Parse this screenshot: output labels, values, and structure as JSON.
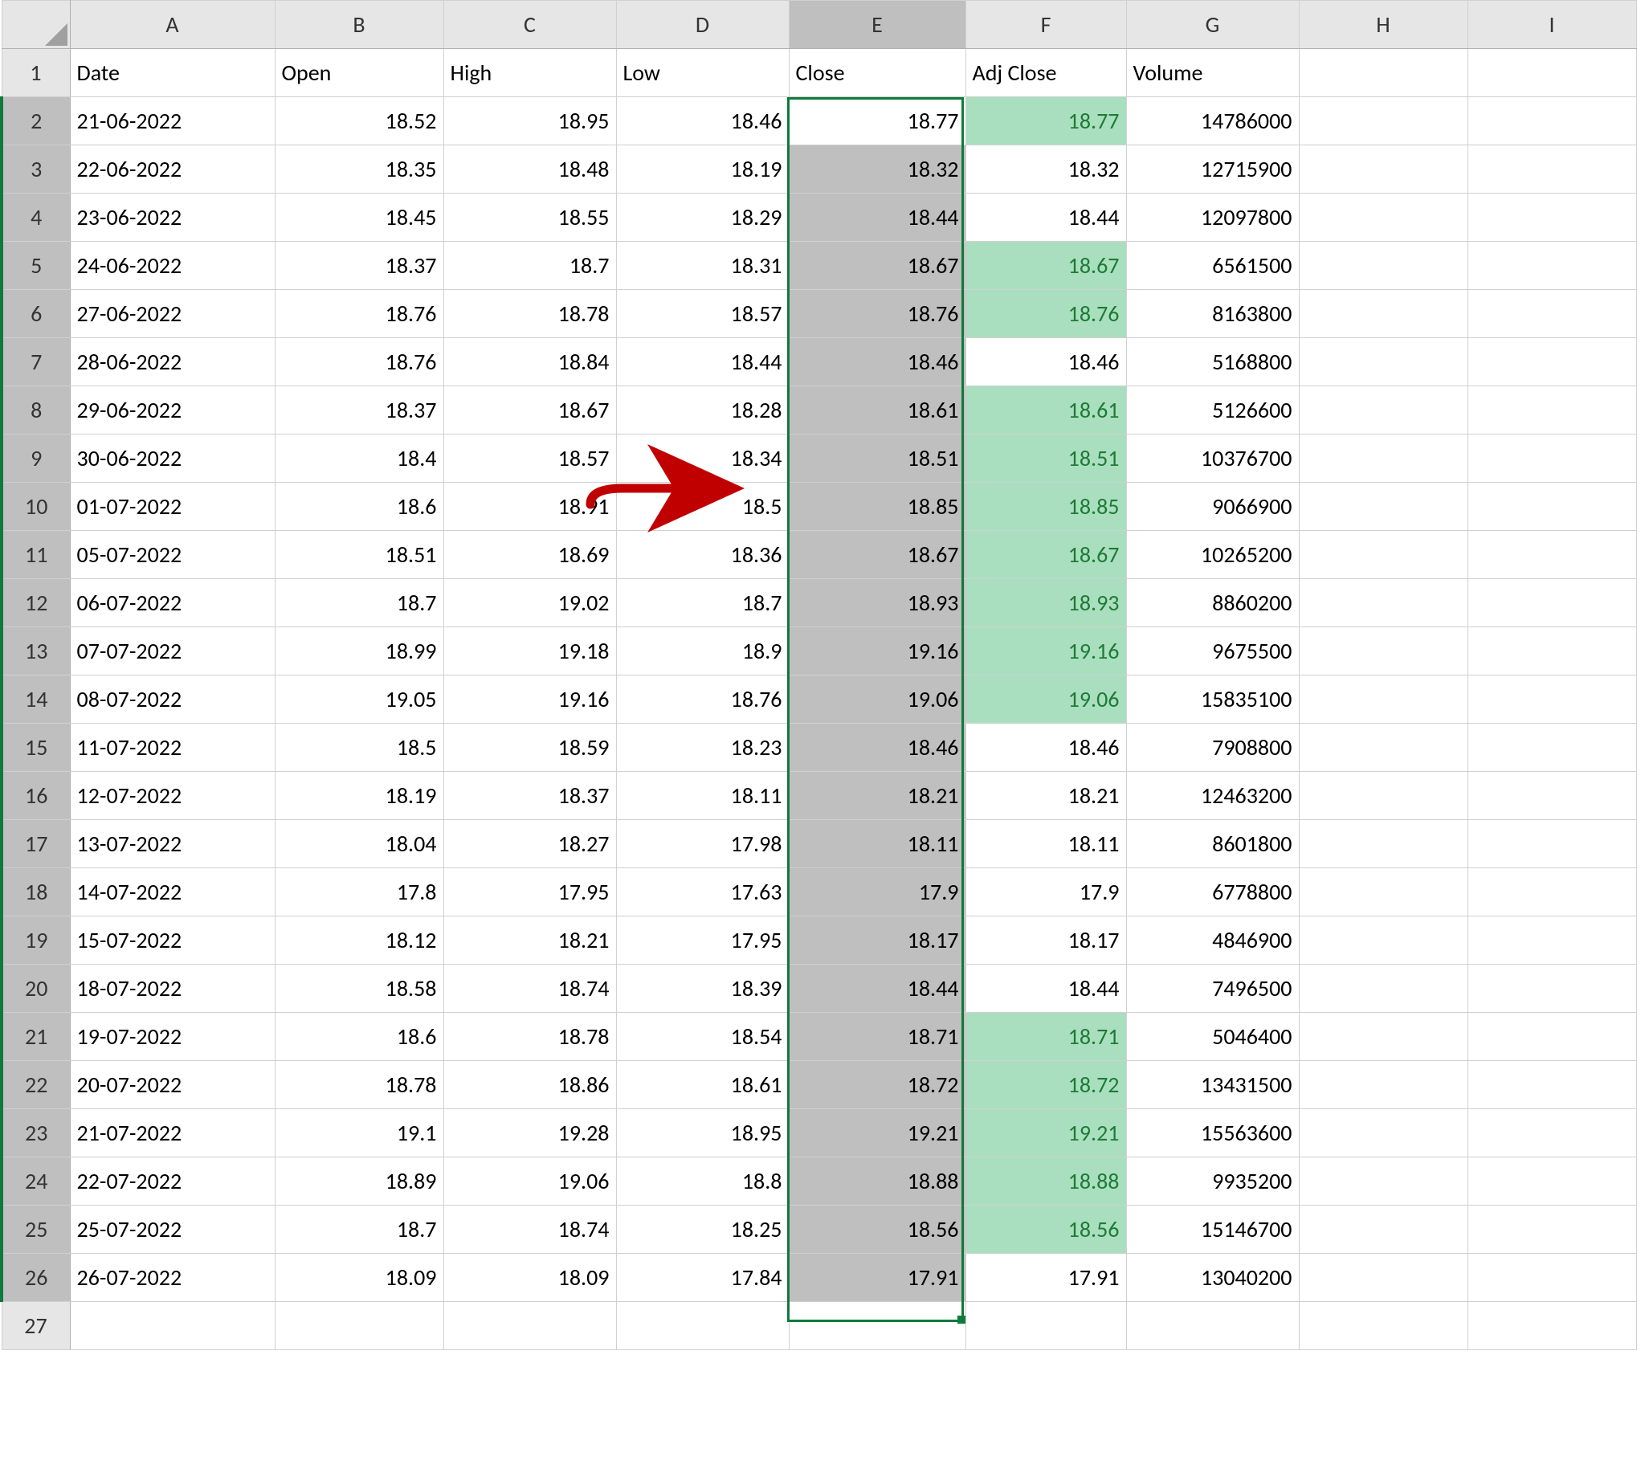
{
  "column_letters": [
    "A",
    "B",
    "C",
    "D",
    "E",
    "F",
    "G",
    "H",
    "I"
  ],
  "headers": {
    "A": "Date",
    "B": "Open",
    "C": "High",
    "D": "Low",
    "E": "Close",
    "F": "Adj Close",
    "G": "Volume"
  },
  "rows": [
    {
      "n": 2,
      "date": "21-06-2022",
      "open": "18.52",
      "high": "18.95",
      "low": "18.46",
      "close": "18.77",
      "adj": "18.77",
      "vol": "14786000",
      "adj_green": true
    },
    {
      "n": 3,
      "date": "22-06-2022",
      "open": "18.35",
      "high": "18.48",
      "low": "18.19",
      "close": "18.32",
      "adj": "18.32",
      "vol": "12715900",
      "adj_green": false
    },
    {
      "n": 4,
      "date": "23-06-2022",
      "open": "18.45",
      "high": "18.55",
      "low": "18.29",
      "close": "18.44",
      "adj": "18.44",
      "vol": "12097800",
      "adj_green": false
    },
    {
      "n": 5,
      "date": "24-06-2022",
      "open": "18.37",
      "high": "18.7",
      "low": "18.31",
      "close": "18.67",
      "adj": "18.67",
      "vol": "6561500",
      "adj_green": true
    },
    {
      "n": 6,
      "date": "27-06-2022",
      "open": "18.76",
      "high": "18.78",
      "low": "18.57",
      "close": "18.76",
      "adj": "18.76",
      "vol": "8163800",
      "adj_green": true
    },
    {
      "n": 7,
      "date": "28-06-2022",
      "open": "18.76",
      "high": "18.84",
      "low": "18.44",
      "close": "18.46",
      "adj": "18.46",
      "vol": "5168800",
      "adj_green": false
    },
    {
      "n": 8,
      "date": "29-06-2022",
      "open": "18.37",
      "high": "18.67",
      "low": "18.28",
      "close": "18.61",
      "adj": "18.61",
      "vol": "5126600",
      "adj_green": true
    },
    {
      "n": 9,
      "date": "30-06-2022",
      "open": "18.4",
      "high": "18.57",
      "low": "18.34",
      "close": "18.51",
      "adj": "18.51",
      "vol": "10376700",
      "adj_green": true
    },
    {
      "n": 10,
      "date": "01-07-2022",
      "open": "18.6",
      "high": "18.91",
      "low": "18.5",
      "close": "18.85",
      "adj": "18.85",
      "vol": "9066900",
      "adj_green": true
    },
    {
      "n": 11,
      "date": "05-07-2022",
      "open": "18.51",
      "high": "18.69",
      "low": "18.36",
      "close": "18.67",
      "adj": "18.67",
      "vol": "10265200",
      "adj_green": true
    },
    {
      "n": 12,
      "date": "06-07-2022",
      "open": "18.7",
      "high": "19.02",
      "low": "18.7",
      "close": "18.93",
      "adj": "18.93",
      "vol": "8860200",
      "adj_green": true
    },
    {
      "n": 13,
      "date": "07-07-2022",
      "open": "18.99",
      "high": "19.18",
      "low": "18.9",
      "close": "19.16",
      "adj": "19.16",
      "vol": "9675500",
      "adj_green": true
    },
    {
      "n": 14,
      "date": "08-07-2022",
      "open": "19.05",
      "high": "19.16",
      "low": "18.76",
      "close": "19.06",
      "adj": "19.06",
      "vol": "15835100",
      "adj_green": true
    },
    {
      "n": 15,
      "date": "11-07-2022",
      "open": "18.5",
      "high": "18.59",
      "low": "18.23",
      "close": "18.46",
      "adj": "18.46",
      "vol": "7908800",
      "adj_green": false
    },
    {
      "n": 16,
      "date": "12-07-2022",
      "open": "18.19",
      "high": "18.37",
      "low": "18.11",
      "close": "18.21",
      "adj": "18.21",
      "vol": "12463200",
      "adj_green": false
    },
    {
      "n": 17,
      "date": "13-07-2022",
      "open": "18.04",
      "high": "18.27",
      "low": "17.98",
      "close": "18.11",
      "adj": "18.11",
      "vol": "8601800",
      "adj_green": false
    },
    {
      "n": 18,
      "date": "14-07-2022",
      "open": "17.8",
      "high": "17.95",
      "low": "17.63",
      "close": "17.9",
      "adj": "17.9",
      "vol": "6778800",
      "adj_green": false
    },
    {
      "n": 19,
      "date": "15-07-2022",
      "open": "18.12",
      "high": "18.21",
      "low": "17.95",
      "close": "18.17",
      "adj": "18.17",
      "vol": "4846900",
      "adj_green": false
    },
    {
      "n": 20,
      "date": "18-07-2022",
      "open": "18.58",
      "high": "18.74",
      "low": "18.39",
      "close": "18.44",
      "adj": "18.44",
      "vol": "7496500",
      "adj_green": false
    },
    {
      "n": 21,
      "date": "19-07-2022",
      "open": "18.6",
      "high": "18.78",
      "low": "18.54",
      "close": "18.71",
      "adj": "18.71",
      "vol": "5046400",
      "adj_green": true
    },
    {
      "n": 22,
      "date": "20-07-2022",
      "open": "18.78",
      "high": "18.86",
      "low": "18.61",
      "close": "18.72",
      "adj": "18.72",
      "vol": "13431500",
      "adj_green": true
    },
    {
      "n": 23,
      "date": "21-07-2022",
      "open": "19.1",
      "high": "19.28",
      "low": "18.95",
      "close": "19.21",
      "adj": "19.21",
      "vol": "15563600",
      "adj_green": true
    },
    {
      "n": 24,
      "date": "22-07-2022",
      "open": "18.89",
      "high": "19.06",
      "low": "18.8",
      "close": "18.88",
      "adj": "18.88",
      "vol": "9935200",
      "adj_green": true
    },
    {
      "n": 25,
      "date": "25-07-2022",
      "open": "18.7",
      "high": "18.74",
      "low": "18.25",
      "close": "18.56",
      "adj": "18.56",
      "vol": "15146700",
      "adj_green": true
    },
    {
      "n": 26,
      "date": "26-07-2022",
      "open": "18.09",
      "high": "18.09",
      "low": "17.84",
      "close": "17.91",
      "adj": "17.91",
      "vol": "13040200",
      "adj_green": false
    }
  ],
  "empty_row": 27,
  "selected_column": "E",
  "active_cell": "E2",
  "selection_range": "E2:E26",
  "annotation": "red-arrow"
}
